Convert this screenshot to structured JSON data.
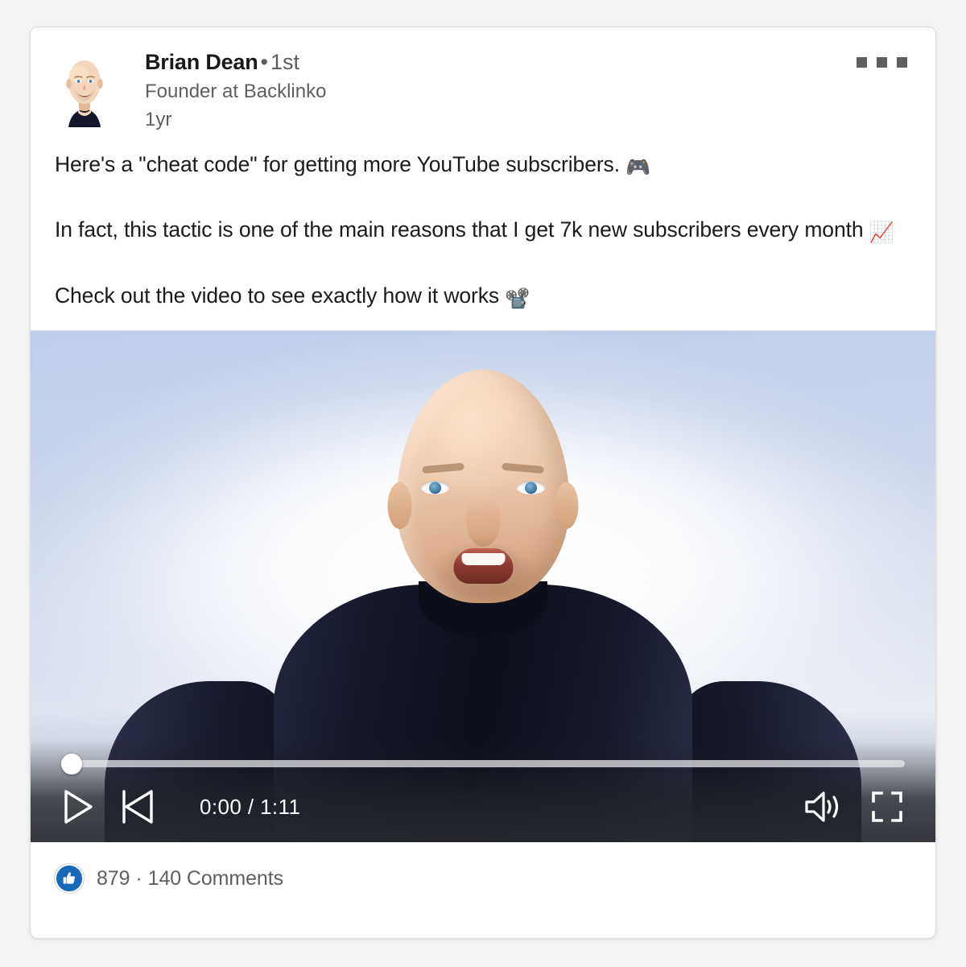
{
  "post": {
    "author": {
      "name": "Brian Dean",
      "separator": "•",
      "degree": "1st",
      "headline": "Founder at Backlinko",
      "timestamp": "1yr",
      "avatar_alt": "brian-dean-avatar"
    },
    "menu_label": "More options",
    "body": {
      "paragraph_1_text": "Here's a \"cheat code\" for getting more YouTube subscribers.",
      "paragraph_1_emoji": "🎮",
      "paragraph_2_text": "In fact, this tactic is one of the main reasons that I get 7k new subscribers every month",
      "paragraph_2_emoji": "📈",
      "paragraph_3_text": "Check out the video to see exactly how it works",
      "paragraph_3_emoji": "📽️"
    },
    "video": {
      "current_time": "0:00",
      "duration": "1:11",
      "time_display": "0:00 / 1:11",
      "progress_percent": 0,
      "play_label": "Play",
      "previous_label": "Previous",
      "volume_label": "Volume",
      "fullscreen_label": "Fullscreen",
      "scrubber_label": "Seek"
    },
    "footer": {
      "reaction_icon": "thumbs-up-icon",
      "reaction_color": "#1668b8",
      "likes": "879",
      "separator": "·",
      "comments": "140 Comments"
    }
  }
}
